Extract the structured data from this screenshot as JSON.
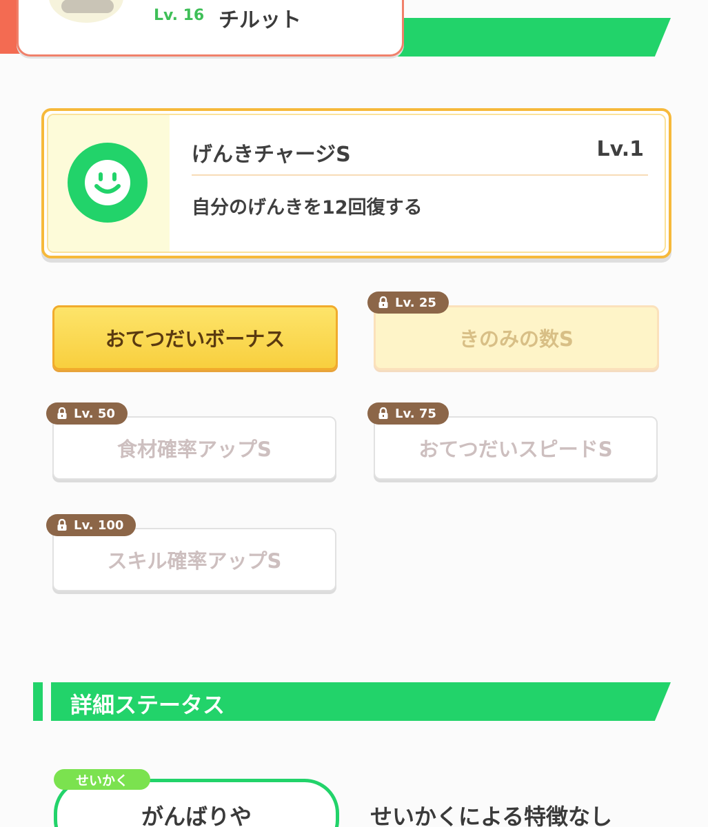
{
  "pokemon": {
    "level": "Lv. 16",
    "name": "チルット"
  },
  "main_skill": {
    "name": "げんきチャージS",
    "level": "Lv.1",
    "description": "自分のげんきを12回復する",
    "icon": "smiley-face-icon",
    "icon_color": "#22d36a"
  },
  "sub_skills": [
    {
      "label": "おてつだいボーナス",
      "lock_level": "",
      "state": "unlocked"
    },
    {
      "label": "きのみの数S",
      "lock_level": "Lv. 25",
      "state": "faded"
    },
    {
      "label": "食材確率アップS",
      "lock_level": "Lv. 50",
      "state": "locked"
    },
    {
      "label": "おてつだいスピードS",
      "lock_level": "Lv. 75",
      "state": "locked"
    },
    {
      "label": "スキル確率アップS",
      "lock_level": "Lv. 100",
      "state": "locked"
    }
  ],
  "details_section": {
    "title": "詳細ステータス"
  },
  "nature": {
    "label": "せいかく",
    "value": "がんばりや",
    "effect": "せいかくによる特徴なし"
  },
  "colors": {
    "accent_green": "#22d36a",
    "header_coral": "#f36b52",
    "gold": "#f6b93b",
    "lock_brown": "#8c6648"
  }
}
